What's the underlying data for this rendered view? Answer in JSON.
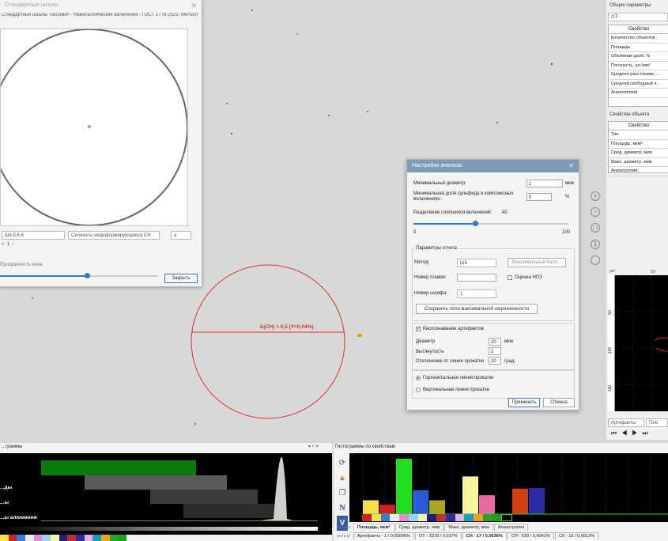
{
  "scales_window": {
    "title": "Стандартные шкалы",
    "subtitle": "Стандартные шкалы Тиксомет - Неметаллические включения - ГОСТ 1778-2022, Метолл",
    "scale_select": "Ш4,5,6,8",
    "type_select": "Силикаты недеформирующиеся СН",
    "grade_select": "а",
    "page_value": "1",
    "opacity_label": "Прозрачность окна",
    "opacity": 0.55,
    "close_button": "Закрыть"
  },
  "overlay": {
    "label": "Б(СН) = 0,5 (V=0,04%)",
    "color": "#e03030"
  },
  "dialog": {
    "title": "Настройки анализа",
    "min_diameter_label": "Минимальный диаметр:",
    "min_diameter_value": "1",
    "min_diameter_unit": "мкм",
    "sulfide_label": "Минимальная доля сульфида в комплексных включениях:",
    "sulfide_value": "0",
    "sulfide_unit": "%",
    "separation_label": "Разделение слипшихся включений:",
    "separation_value": "40",
    "separation_min": "0",
    "separation_max": "100",
    "report_group": "Параметры отчета",
    "method_label": "Метод:",
    "method_value": "Ш6",
    "max_score_button": "Максимальный балл...",
    "heat_label": "Номер плавки:",
    "npz_label": "Оценка НПЗ",
    "section_label": "Номер шлифа:",
    "section_value": "1",
    "save_fields_button": "Сохранить поля максимальной загрязненности",
    "artefacts_label": "Распознавание артефактов",
    "diameter_label": "Диаметр",
    "diameter_value": "20",
    "diameter_unit": "мкм",
    "elongation_label": "Вытянутость",
    "elongation_value": "2",
    "deviation_label": "Отклонение от линии прокатки",
    "deviation_value": "20",
    "deviation_unit": "град.",
    "horizontal_label": "Горизонтальная линия прокатки",
    "vertical_label": "Вертикальная линия прокатки",
    "apply_button": "Применить",
    "cancel_button": "Отмена"
  },
  "right_panel": {
    "general_title": "Общие параметры",
    "general_select": "ОТ",
    "col_header": "Свойство",
    "general_rows": [
      "Количество объектов",
      "Площадь",
      "Объёмная доля, %",
      "Плотность, шт./мм²",
      "Среднее расстояние, ...",
      "Средний свободный п...",
      "Анизотропия"
    ],
    "object_title": "Свойства объекта",
    "object_rows": [
      "Тип",
      "Площадь, мкм²",
      "Сред. диаметр, мкм",
      "Макс. диаметр, мкм",
      "Анизотропия"
    ],
    "axis_unit": "µm",
    "axis_top": "50",
    "axis_left": [
      "50",
      "100",
      "150"
    ],
    "bottom_select": "Артефакты",
    "bottom_select2": "Пло"
  },
  "bottom_left": {
    "title": "...граммы",
    "labels": [
      "...ды",
      "...ы",
      "...ы алюминия"
    ]
  },
  "bottom_right": {
    "title": "Гистограммы по свойствам",
    "tabs": [
      "Площадь, мкм²",
      "Сред. диаметр, мкм",
      "Макс. диаметр, мкм",
      "Анизотропия"
    ],
    "class_tabs": [
      "Артефакты - 1 / 0,00006%",
      "ОТ - 3378 / 0,037%",
      "СН - 17 / 0,0036%",
      "СП - 539 / 0,0041%",
      "СХ - 16 / 0,0013%"
    ]
  },
  "colors": {
    "accent": "#2a7bd3",
    "overlay": "#e03030",
    "dialog_title": "#7d9ab8"
  },
  "chart_data": {
    "type": "bar",
    "values": [
      0.25,
      0.17,
      1.0,
      0.43,
      0.25,
      0.0,
      0.68,
      0.34,
      0.0,
      0.46,
      0.47,
      0.0,
      0.0
    ]
  }
}
